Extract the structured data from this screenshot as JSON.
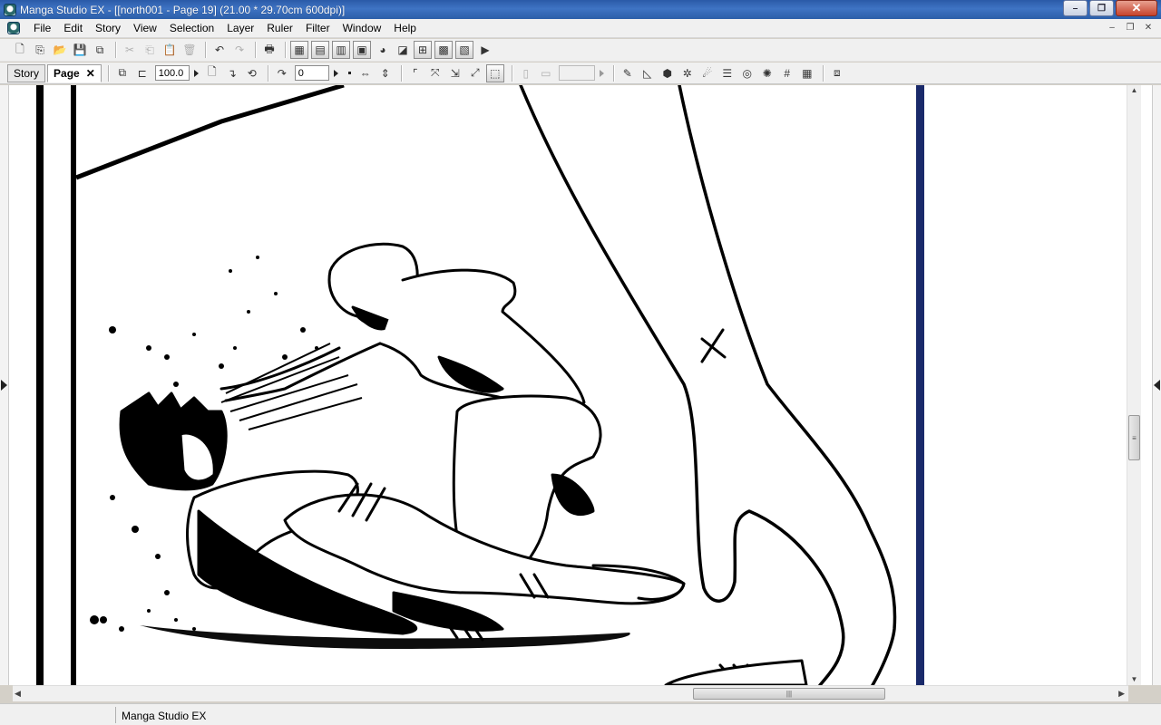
{
  "window": {
    "title": "Manga Studio EX - [[north001 - Page 19] (21.00 * 29.70cm 600dpi)]",
    "controls": {
      "minimize": "–",
      "maximize": "❐",
      "close": "✕"
    }
  },
  "menubar": {
    "items": [
      "File",
      "Edit",
      "Story",
      "View",
      "Selection",
      "Layer",
      "Ruler",
      "Filter",
      "Window",
      "Help"
    ],
    "mdi_controls": {
      "minimize": "–",
      "restore": "❐",
      "close": "✕"
    }
  },
  "toolbar2": {
    "tabs": [
      {
        "label": "Story",
        "active": false
      },
      {
        "label": "Page",
        "active": true
      }
    ],
    "tab_close": "✕",
    "zoom_value": "100.0",
    "rotate_value": "0"
  },
  "status": {
    "text": "Manga Studio EX"
  },
  "colors": {
    "titlebar": "#3f74c4",
    "chrome": "#f0f0f0",
    "page_border": "#000000",
    "page_edge_blue": "#1a2a6a"
  }
}
